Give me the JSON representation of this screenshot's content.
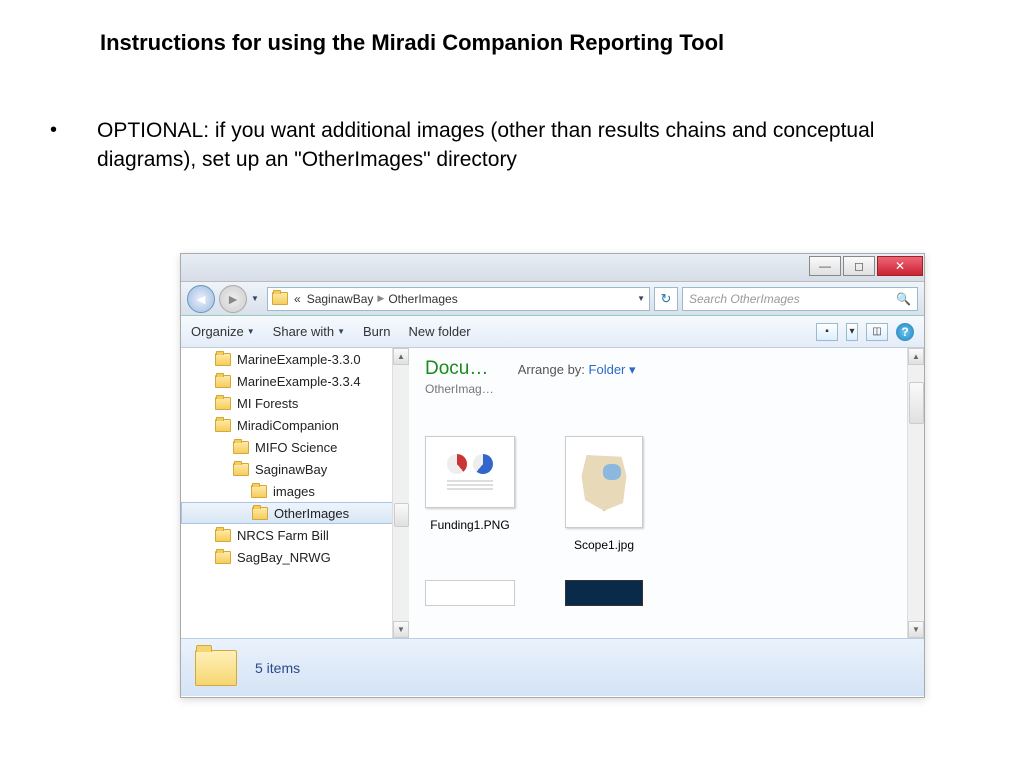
{
  "slide": {
    "title": "Instructions for using the Miradi Companion Reporting Tool",
    "bullet": "OPTIONAL: if you want additional images (other than results chains and conceptual diagrams), set up an \"OtherImages\" directory"
  },
  "explorer": {
    "breadcrumb": {
      "prefix": "«",
      "seg1": "SaginawBay",
      "seg2": "OtherImages"
    },
    "search_placeholder": "Search OtherImages",
    "toolbar": {
      "organize": "Organize",
      "share": "Share with",
      "burn": "Burn",
      "newfolder": "New folder"
    },
    "tree": [
      {
        "label": "MarineExample-3.3.0",
        "indent": 0
      },
      {
        "label": "MarineExample-3.3.4",
        "indent": 0
      },
      {
        "label": "MI Forests",
        "indent": 0
      },
      {
        "label": "MiradiCompanion",
        "indent": 0
      },
      {
        "label": "MIFO Science",
        "indent": 1
      },
      {
        "label": "SaginawBay",
        "indent": 1
      },
      {
        "label": "images",
        "indent": 2
      },
      {
        "label": "OtherImages",
        "indent": 2,
        "sel": true
      },
      {
        "label": "NRCS Farm Bill",
        "indent": 0
      },
      {
        "label": "SagBay_NRWG",
        "indent": 0
      }
    ],
    "library": {
      "title": "Docu…",
      "subtitle": "OtherImag…",
      "arrange_label": "Arrange by:",
      "arrange_value": "Folder"
    },
    "thumbs": {
      "t1": "Funding1.PNG",
      "t2": "Scope1.jpg"
    },
    "status": "5 items"
  }
}
